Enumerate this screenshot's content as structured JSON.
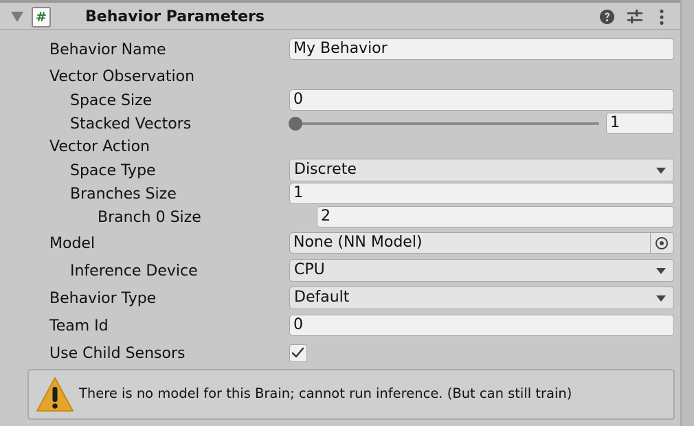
{
  "component": {
    "title": "Behavior Parameters",
    "script_icon_glyph": "#"
  },
  "header_icons": {
    "help": "help-icon",
    "presets": "preset-sliders-icon",
    "menu": "kebab-menu-icon"
  },
  "fields": {
    "behavior_name": {
      "label": "Behavior Name",
      "value": "My Behavior"
    },
    "vector_observation": {
      "label": "Vector Observation"
    },
    "space_size": {
      "label": "Space Size",
      "value": "0"
    },
    "stacked_vectors": {
      "label": "Stacked Vectors",
      "value": "1",
      "slider_fraction": 0.0
    },
    "vector_action": {
      "label": "Vector Action"
    },
    "space_type": {
      "label": "Space Type",
      "value": "Discrete"
    },
    "branches_size": {
      "label": "Branches Size",
      "value": "1"
    },
    "branch_0_size": {
      "label": "Branch 0 Size",
      "value": "2"
    },
    "model": {
      "label": "Model",
      "value": "None (NN Model)"
    },
    "inference_device": {
      "label": "Inference Device",
      "value": "CPU"
    },
    "behavior_type": {
      "label": "Behavior Type",
      "value": "Default"
    },
    "team_id": {
      "label": "Team Id",
      "value": "0"
    },
    "use_child_sensors": {
      "label": "Use Child Sensors",
      "checked": true
    }
  },
  "warning": {
    "text": "There is no model for this Brain; cannot run inference. (But can still train)",
    "icon_color": "#e3a52b"
  },
  "colors": {
    "script_hash": "#2e7d32"
  }
}
